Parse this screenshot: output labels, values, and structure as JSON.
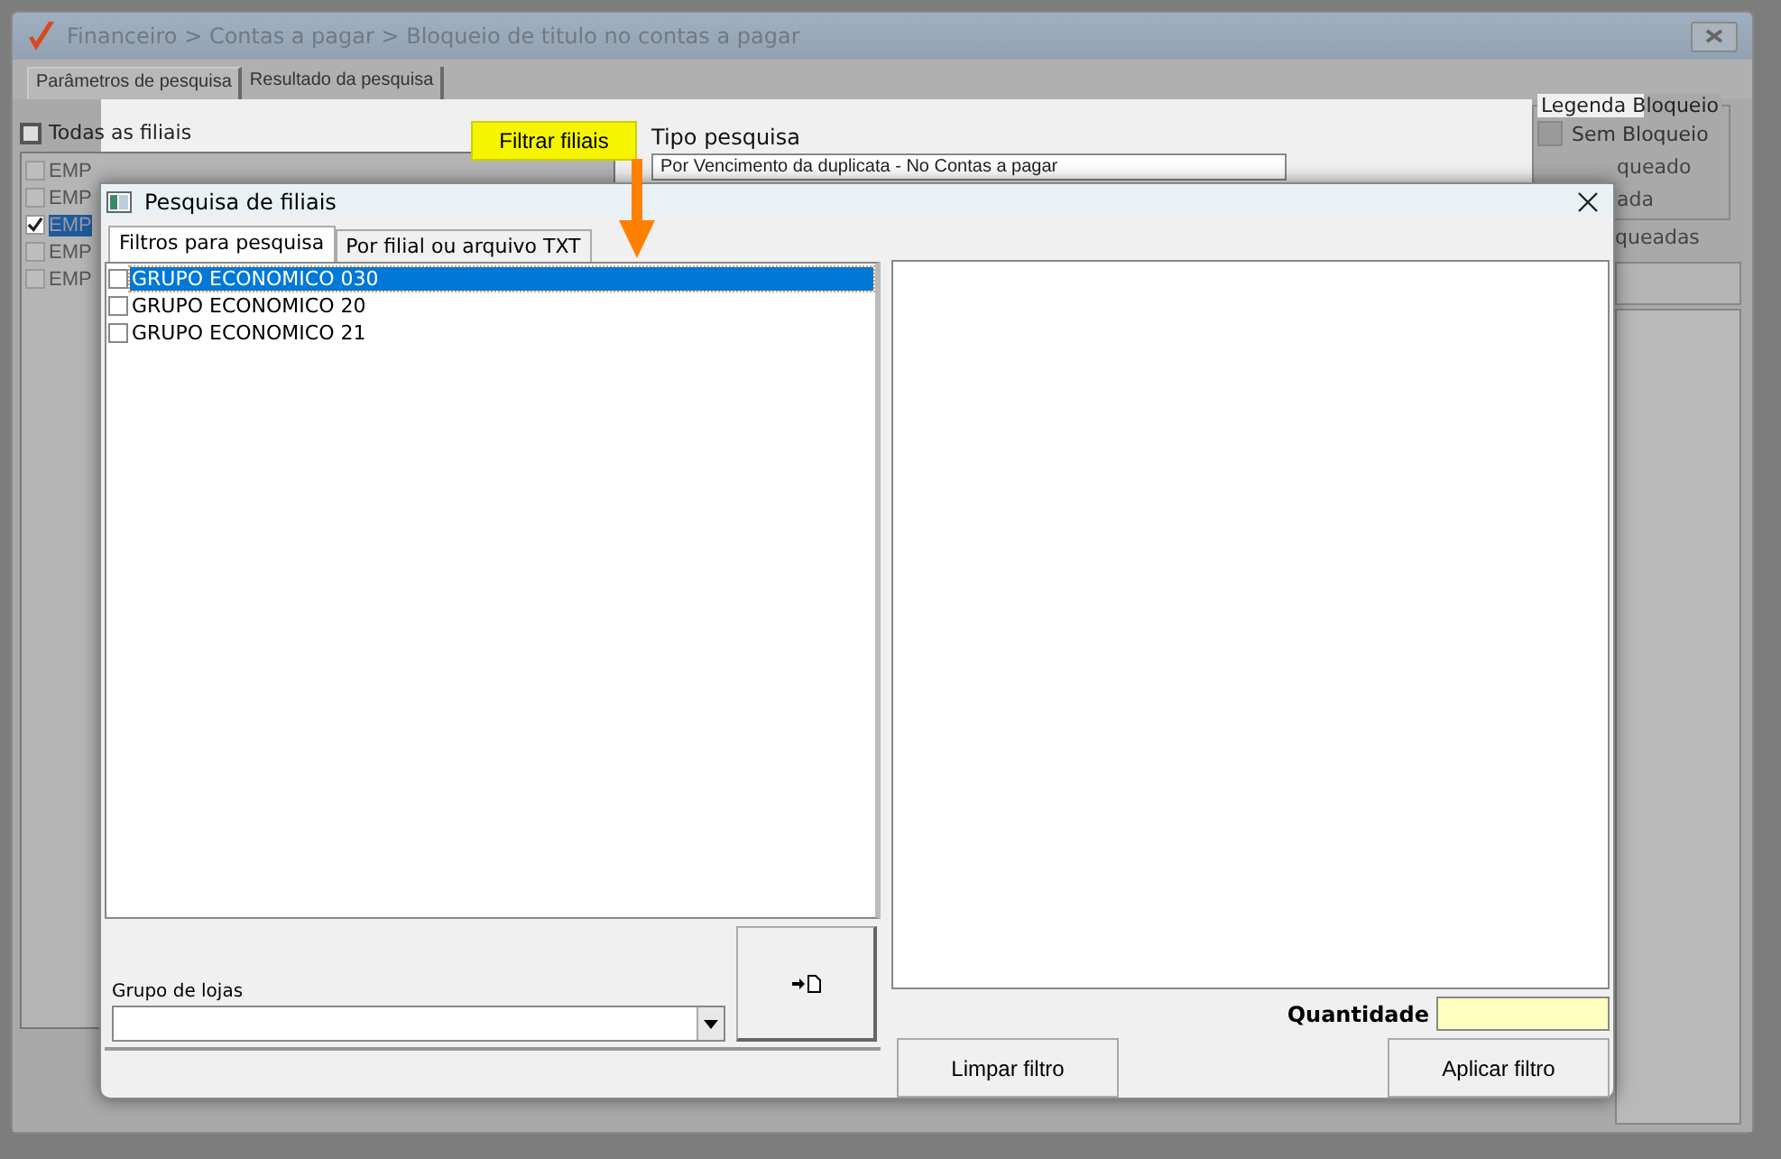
{
  "window": {
    "title": "Financeiro > Contas a pagar > Bloqueio de titulo no contas a pagar"
  },
  "tabs": [
    {
      "label": "Parâmetros de pesquisa",
      "selected": true
    },
    {
      "label": "Resultado da pesquisa",
      "selected": false
    }
  ],
  "all_branches": {
    "label": "Todas as filiais",
    "checked": false
  },
  "branches": [
    {
      "label": "EMP",
      "checked": false,
      "selected": false
    },
    {
      "label": "EMP",
      "checked": false,
      "selected": false
    },
    {
      "label": "EMP",
      "checked": true,
      "selected": true
    },
    {
      "label": "EMP",
      "checked": false,
      "selected": false
    },
    {
      "label": "EMP",
      "checked": false,
      "selected": false
    }
  ],
  "filter_button": {
    "label": "Filtrar filiais"
  },
  "search_type": {
    "label": "Tipo pesquisa",
    "value": "Por Vencimento da duplicata - No Contas a pagar"
  },
  "legend": {
    "title": "Legenda Bloqueio",
    "items": [
      "Sem Bloqueio",
      "queado",
      "ada"
    ],
    "note": "queadas"
  },
  "dialog": {
    "title": "Pesquisa de filiais",
    "tabs": [
      {
        "label": "Filtros para pesquisa",
        "selected": true
      },
      {
        "label": "Por filial ou arquivo TXT",
        "selected": false
      }
    ],
    "groups": [
      {
        "label": "GRUPO ECONOMICO 030",
        "checked": false,
        "selected": true
      },
      {
        "label": "GRUPO ECONOMICO 20",
        "checked": false,
        "selected": false
      },
      {
        "label": "GRUPO ECONOMICO 21",
        "checked": false,
        "selected": false
      }
    ],
    "store_group": {
      "label": "Grupo de lojas"
    },
    "quantity": {
      "label": "Quantidade"
    },
    "buttons": [
      "Limpar filtro",
      "Aplicar filtro"
    ]
  }
}
